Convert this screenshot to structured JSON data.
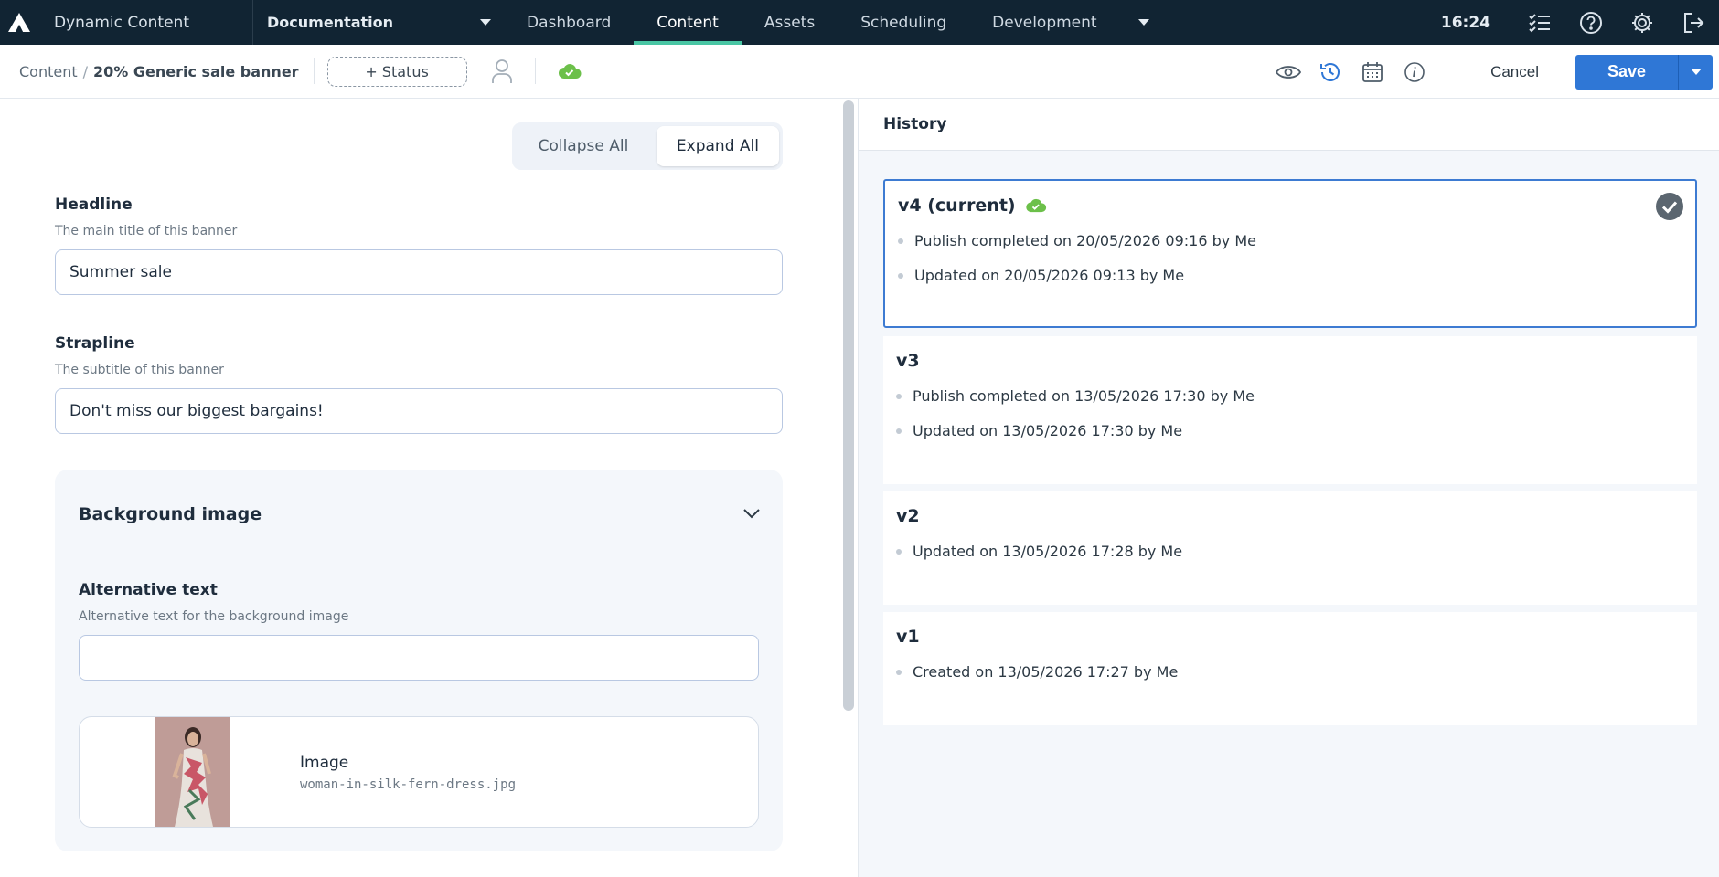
{
  "topbar": {
    "app_name": "Dynamic Content",
    "hub": "Documentation",
    "nav": [
      "Dashboard",
      "Content",
      "Assets",
      "Scheduling",
      "Development"
    ],
    "active_nav": "Content",
    "time": "16:24"
  },
  "toolbar": {
    "breadcrumb_root": "Content",
    "breadcrumb_sep": "/",
    "breadcrumb_current": "20% Generic sale banner",
    "status_label": "+ Status",
    "cancel_label": "Cancel",
    "save_label": "Save"
  },
  "editor": {
    "collapse_label": "Collapse All",
    "expand_label": "Expand All",
    "headline": {
      "label": "Headline",
      "help": "The main title of this banner",
      "value": "Summer sale"
    },
    "strapline": {
      "label": "Strapline",
      "help": "The subtitle of this banner",
      "value": "Don't miss our biggest bargains!"
    },
    "background": {
      "title": "Background image",
      "alt_label": "Alternative text",
      "alt_help": "Alternative text for the background image",
      "alt_value": "",
      "image_label": "Image",
      "image_file": "woman-in-silk-fern-dress.jpg"
    }
  },
  "history": {
    "title": "History",
    "versions": [
      {
        "name": "v4 (current)",
        "published": true,
        "current": true,
        "events": [
          "Publish completed on 20/05/2026 09:16 by Me",
          "Updated on 20/05/2026 09:13 by Me"
        ]
      },
      {
        "name": "v3",
        "published": false,
        "current": false,
        "events": [
          "Publish completed on 13/05/2026 17:30 by Me",
          "Updated on 13/05/2026 17:30 by Me"
        ]
      },
      {
        "name": "v2",
        "published": false,
        "current": false,
        "events": [
          "Updated on 13/05/2026 17:28 by Me"
        ]
      },
      {
        "name": "v1",
        "published": false,
        "current": false,
        "events": [
          "Created on 13/05/2026 17:27 by Me"
        ]
      }
    ]
  },
  "colors": {
    "nav_bg": "#112433",
    "accent": "#49c6a4",
    "primary": "#2f77d6",
    "published": "#6cc04a"
  }
}
